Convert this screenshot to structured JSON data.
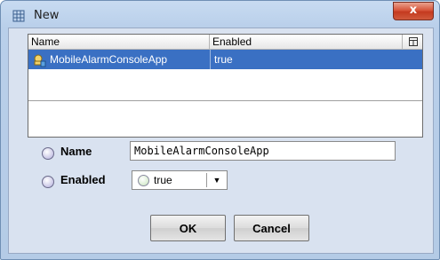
{
  "window": {
    "title": "New",
    "title_icon": "grid-app-icon",
    "close_label": "x"
  },
  "table": {
    "columns": [
      "Name",
      "Enabled"
    ],
    "column_menu_icon": "column-chooser-icon",
    "rows": [
      {
        "icon": "alarm-app-icon",
        "name": "MobileAlarmConsoleApp",
        "enabled": "true"
      }
    ]
  },
  "form": {
    "name_label": "Name",
    "name_value": "MobileAlarmConsoleApp",
    "enabled_label": "Enabled",
    "enabled_value": "true"
  },
  "buttons": {
    "ok": "OK",
    "cancel": "Cancel"
  },
  "colors": {
    "selection": "#3a70c3",
    "title_bar": "#b9cfea",
    "close": "#c43a1f"
  }
}
